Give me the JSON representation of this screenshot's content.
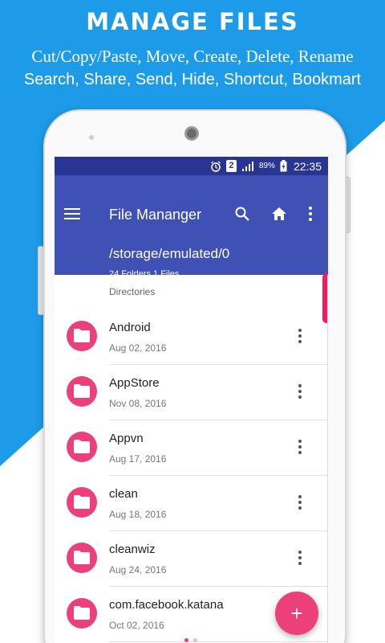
{
  "promo": {
    "title": "MANAGE FILES",
    "line1": "Cut/Copy/Paste, Move, Create, Delete, Rename",
    "line2": "Search, Share, Send, Hide, Shortcut, Bookmart"
  },
  "status_bar": {
    "sim": "2",
    "battery": "89%",
    "time": "22:35",
    "icons": [
      "alarm-icon",
      "sim-icon",
      "signal-icon",
      "battery-charging-icon"
    ]
  },
  "app_bar": {
    "title": "File Mananger",
    "path": "/storage/emulated/0",
    "counts": "24 Folders 1 Files",
    "icons": [
      "menu-icon",
      "search-icon",
      "home-icon",
      "more-vert-icon"
    ]
  },
  "section": {
    "header": "Directories"
  },
  "items": [
    {
      "name": "Android",
      "date": "Aug 02, 2016"
    },
    {
      "name": "AppStore",
      "date": "Nov 08, 2016"
    },
    {
      "name": "Appvn",
      "date": "Aug 17, 2016"
    },
    {
      "name": "clean",
      "date": "Aug 18, 2016"
    },
    {
      "name": "cleanwiz",
      "date": "Aug 24, 2016"
    },
    {
      "name": "com.facebook.katana",
      "date": "Oct 02, 2016"
    }
  ],
  "fab": {
    "label": "+"
  },
  "colors": {
    "background_blue": "#1e9be8",
    "status_bar": "#283593",
    "app_bar": "#3f51b5",
    "accent_pink": "#ec407a"
  }
}
